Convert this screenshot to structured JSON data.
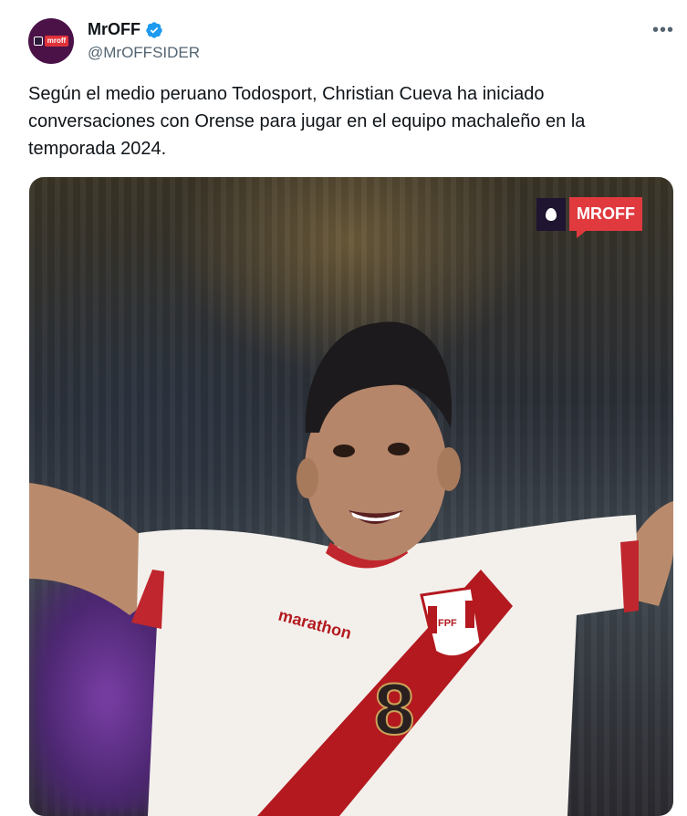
{
  "author": {
    "display_name": "MrOFF",
    "handle": "@MrOFFSIDER",
    "avatar_text": "mroff",
    "verified": true
  },
  "tweet": {
    "text": "Según el medio peruano Todosport, Christian Cueva ha iniciado conversaciones con Orense para jugar en el equipo machaleño en la temporada 2024."
  },
  "media": {
    "watermark_text": "MROFF",
    "jersey_sponsor": "marathon",
    "jersey_number": "8",
    "badge_text": "FPF"
  },
  "colors": {
    "verified_blue": "#1d9bf0",
    "brand_red": "#e03a3e",
    "jersey_red": "#b3191f",
    "text_secondary": "#536471"
  },
  "icons": {
    "more": "more-horizontal-icon",
    "verified": "verified-badge-icon"
  }
}
